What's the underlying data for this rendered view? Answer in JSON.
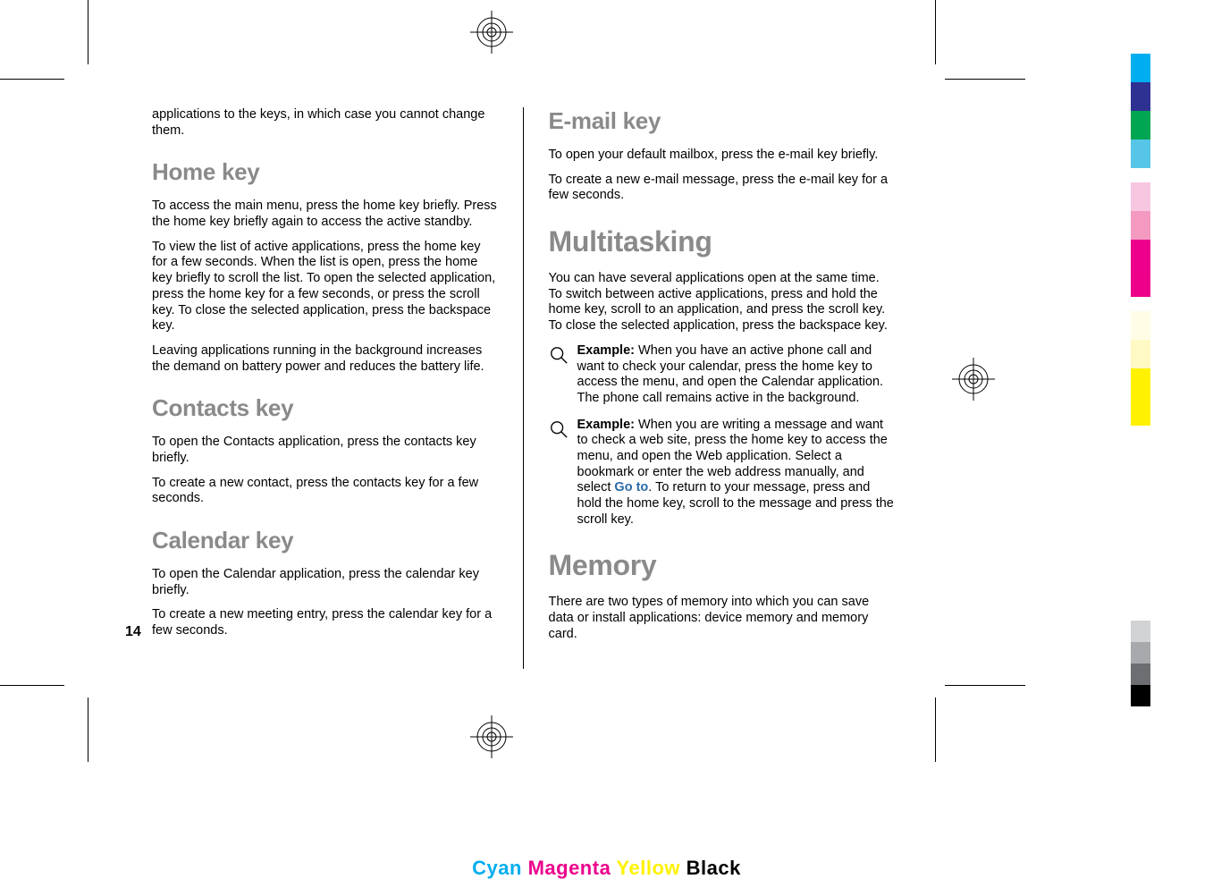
{
  "page_number": "14",
  "left_column": {
    "intro_text": "applications to the keys, in which case you cannot change them.",
    "sections": [
      {
        "heading": "Home key",
        "paragraphs": [
          "To access the main menu, press the home key briefly. Press the home key briefly again to access the active standby.",
          "To view the list of active applications, press the home key for a few seconds. When the list is open, press the home key briefly to scroll the list. To open the selected application, press the home key for a few seconds, or press the scroll key. To close the selected application, press the backspace key.",
          "Leaving applications running in the background increases the demand on battery power and reduces the battery life."
        ]
      },
      {
        "heading": "Contacts key",
        "paragraphs": [
          "To open the Contacts application, press the contacts key briefly.",
          "To create a new contact, press the contacts key for a few seconds."
        ]
      },
      {
        "heading": "Calendar key",
        "paragraphs": [
          "To open the Calendar application, press the calendar key briefly.",
          "To create a new meeting entry, press the calendar key for a few seconds."
        ]
      }
    ]
  },
  "right_column": {
    "sections": [
      {
        "heading": "E-mail key",
        "level": "h2",
        "paragraphs": [
          "To open your default mailbox, press the e-mail key briefly.",
          "To create a new e-mail message, press the e-mail key for a few seconds."
        ]
      },
      {
        "heading": "Multitasking",
        "level": "h1",
        "paragraphs": [
          "You can have several applications open at the same time. To switch between active applications, press and hold the home key, scroll to an application, and press the scroll key. To close the selected application, press the backspace key."
        ],
        "examples": [
          {
            "label": "Example:",
            "text": "  When you have an active phone call and want to check your calendar, press the home key to access the menu, and open the Calendar application. The phone call remains active in the background."
          },
          {
            "label": "Example:",
            "text_before": "  When you are writing a message and want to check a web site, press the home key to access the menu, and open the Web application. Select a bookmark or enter the web address manually, and select ",
            "goto": "Go to",
            "text_after": ". To return to your message, press and hold the home key, scroll to the message and press the scroll key."
          }
        ]
      },
      {
        "heading": "Memory",
        "level": "h1",
        "paragraphs": [
          "There are two types of memory into which you can save data or install applications: device memory and memory card."
        ]
      }
    ]
  },
  "cmyk": {
    "cyan": "Cyan",
    "magenta": "Magenta",
    "yellow": "Yellow",
    "black": "Black"
  },
  "color_bars_top": [
    "#00aeef",
    "#2e3192",
    "#00a651",
    "#57c5e8"
  ],
  "color_bars_mid": [
    "#f7c6e0",
    "#f49ac1",
    "#ec008c",
    "#ed008a"
  ],
  "color_bars_yellow": [
    "#fffde5",
    "#fff9c4",
    "#fff200",
    "#fff200"
  ],
  "color_bars_gray": [
    "#d1d3d4",
    "#a7a9ac",
    "#6d6e71",
    "#000000"
  ]
}
